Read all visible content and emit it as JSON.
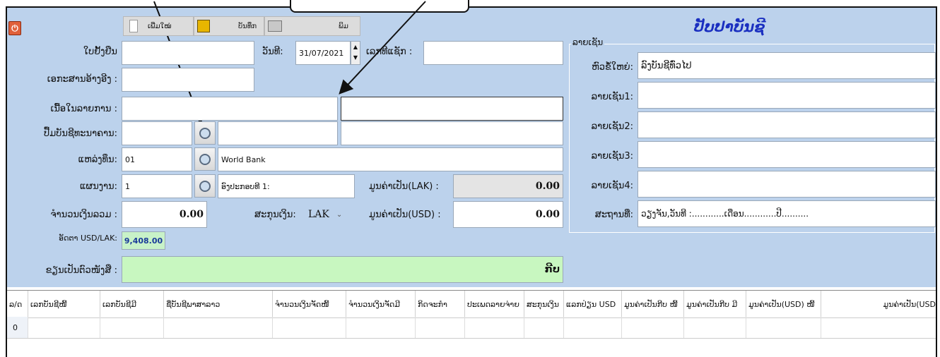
{
  "toolbar": {
    "new_label": "ເພີ່ມໃໝ່",
    "save_label": "ບັນທຶກ",
    "print_label": "ພິມ"
  },
  "title": "ປັບປາບັນຊີ",
  "form": {
    "voucher_label": "ໃບຢັ້ງຢືນ",
    "date_label": "ວັນທີ:",
    "date_value": "31/07/2021",
    "no_label": "ເລກທີແຊັກ :",
    "ref_label": "ເອກະສານອ້າງອີງ :",
    "desc_label": "ເນື້ອໃນລາຍການ :",
    "bank_label": "ປື້ມບັນຊີທະນາຄານ:",
    "source_label": "ແຫລ່ງທຶນ:",
    "source_code": "01",
    "source_name": "World Bank",
    "plan_label": "ແຜນງານ:",
    "plan_code": "1",
    "plan_name": "ອົງປະກອບທີ 1:",
    "value_lak_label": "ມູນຄ່າເປັນ(LAK) :",
    "value_lak": "0.00",
    "total_label": "ຈຳນວນເງິນລວມ :",
    "total_value": "0.00",
    "currency_label": "ສະກຸນເງິນ:",
    "currency_value": "LAK",
    "value_usd_label": "ມູນຄ່າເປັນ(USD) :",
    "value_usd": "0.00",
    "rate_label": "ອັດຕາ USD/LAK:",
    "rate_value": "9,408.00",
    "words_label": "ຂຽນເປັນຕົວໜັງສື :",
    "words_value": "ກີບ"
  },
  "signatures": {
    "group_label": "ລາຍເຊັນ",
    "header_label": "ຫົວຂໍ້ໃຫຍ່:",
    "header_value": "ລົງບັນຊີທົ່ວໄປ",
    "sig1_label": "ລາຍເຊັນ1:",
    "sig2_label": "ລາຍເຊັນ2:",
    "sig3_label": "ລາຍເຊັນ3:",
    "sig4_label": "ລາຍເຊັນ4:",
    "place_label": "ສະຖານທີ່:",
    "place_value": "ວຽງຈັນ,ວັນທີ :............ເດືອນ............ປີ.........."
  },
  "table": {
    "columns": [
      "ລ/ດ",
      "ເລກບັນຊີໜີ້",
      "ເລກບັນຊີມີ",
      "ຊື່ບັນຊີພາສາລາວ",
      "ຈຳນວນເງິນຈັດໜີ້",
      "ຈຳນວນເງິນຈັດມີ",
      "ກິດຈະກຳ",
      "ປະເພດລາຍຈ່າຍ",
      "ສະກຸນເງິນ",
      "ແລກປ່ຽນ USD",
      "ມູນຄ່າເປັນກີບ ໜີ້",
      "ມູນຄ່າເປັນກີບ ມີ",
      "ມູນຄ່າເປັນ(USD) ໜີ້",
      "ມູນຄ່າເປັນ(USD"
    ],
    "rows": [
      {
        "index": "0"
      }
    ]
  },
  "colors": {
    "form_bg": "#bcd2ec",
    "rate_bg": "#c8f2c8",
    "words_bg": "#c8f7c0",
    "title": "#1a2fc0"
  }
}
